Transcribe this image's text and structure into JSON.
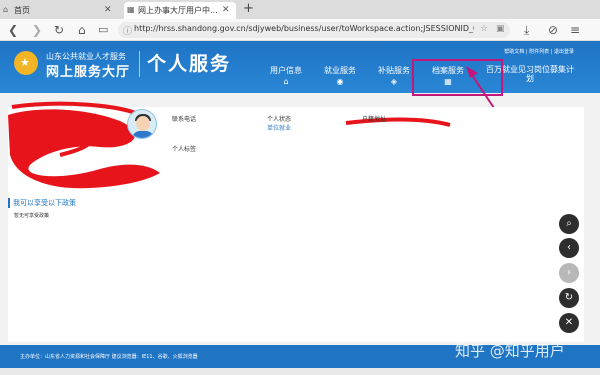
{
  "browser": {
    "tabs": [
      {
        "label": "首页"
      },
      {
        "label": "网上办事大厅用户中..."
      }
    ],
    "url": "http://hrss.shandong.gov.cn/sdjyweb/business/user/toWorkspace.action;JSESSIONID_GGFWDT..."
  },
  "header": {
    "org_line1": "山东公共就业人才服务",
    "org_line2": "网上服务大厅",
    "page_title": "个人服务",
    "toplinks": "帮助文档 | 附件列表 | 退出登录",
    "nav": [
      {
        "label": "用户信息"
      },
      {
        "label": "就业服务"
      },
      {
        "label": "补贴服务"
      },
      {
        "label": "档案服务"
      },
      {
        "label": "百万就业见习岗位募集计划"
      }
    ]
  },
  "profile": {
    "labels": {
      "phone": "联系电话",
      "status": "个人状态",
      "address": "户籍地址",
      "tags": "个人标签"
    },
    "status_value": "单位就业"
  },
  "policy": {
    "title": "我可以享受以下政策",
    "empty": "暂无可享受政策"
  },
  "footer": {
    "text": "主办单位：山东省人力资源和社会保障厅   建议浏览器：IE11、谷歌、火狐浏览器"
  },
  "watermark": "知乎 @知乎用户",
  "colors": {
    "brand": "#1f74c4",
    "annotation": "#c2187a",
    "scribble": "#e8141c"
  },
  "icons": [
    "home-icon",
    "back-icon",
    "forward-icon",
    "reload-icon",
    "tabs-icon",
    "search-icon",
    "star-icon",
    "download-icon",
    "menu-icon",
    "close-icon",
    "arrow-left-icon",
    "arrow-right-icon",
    "refresh-icon"
  ]
}
